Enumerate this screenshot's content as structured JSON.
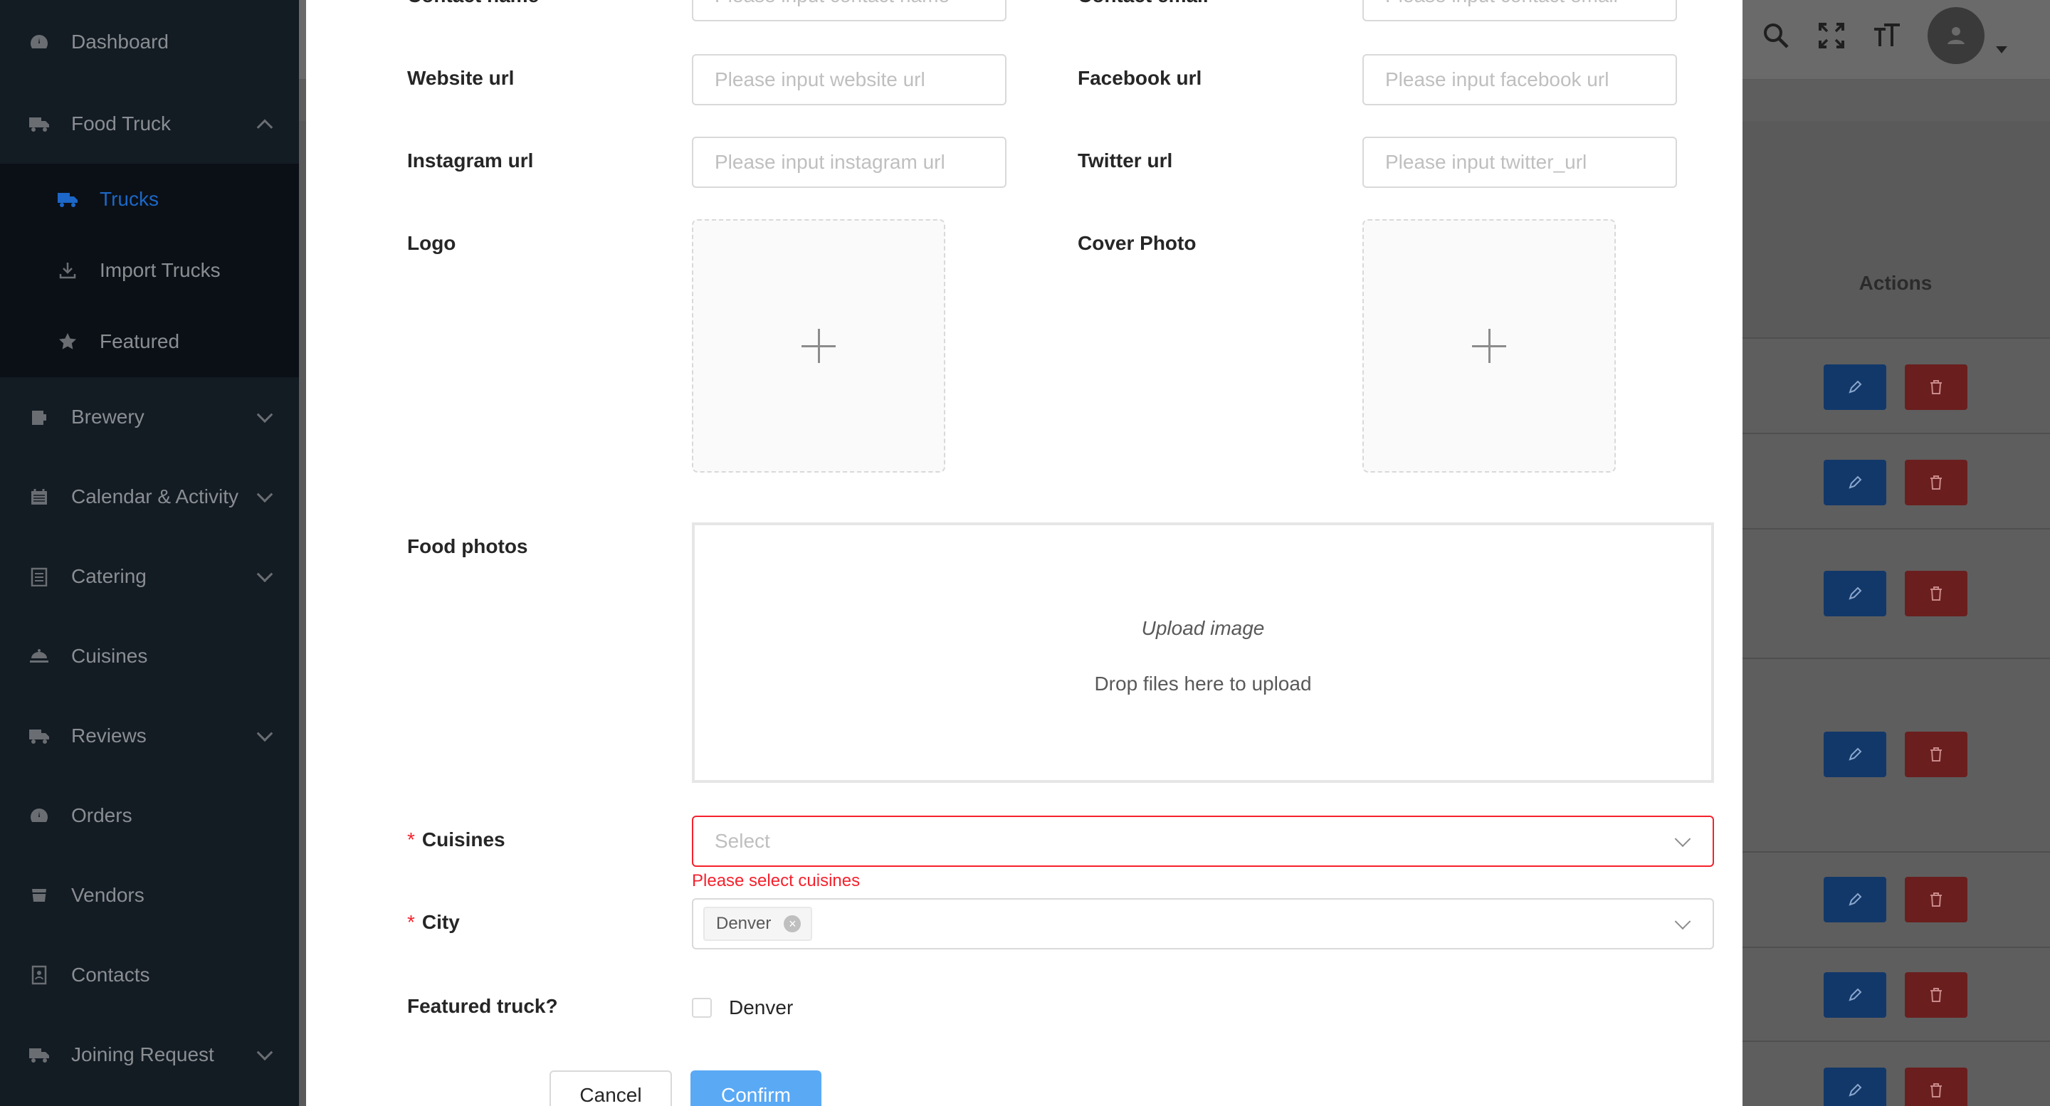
{
  "sidebar": {
    "items": [
      {
        "label": "Dashboard",
        "icon": "dashboard-icon"
      },
      {
        "label": "Food Truck",
        "icon": "truck-icon",
        "expanded": true,
        "children": [
          {
            "label": "Trucks",
            "icon": "truck-icon",
            "active": true
          },
          {
            "label": "Import Trucks",
            "icon": "download-icon"
          },
          {
            "label": "Featured",
            "icon": "star-icon"
          }
        ]
      },
      {
        "label": "Brewery",
        "icon": "beer-icon"
      },
      {
        "label": "Calendar & Activity",
        "icon": "calendar-icon"
      },
      {
        "label": "Catering",
        "icon": "clipboard-icon"
      },
      {
        "label": "Cuisines",
        "icon": "dish-icon"
      },
      {
        "label": "Reviews",
        "icon": "truck-icon"
      },
      {
        "label": "Orders",
        "icon": "dashboard-icon"
      },
      {
        "label": "Vendors",
        "icon": "vendor-icon"
      },
      {
        "label": "Contacts",
        "icon": "contacts-icon"
      },
      {
        "label": "Joining Request",
        "icon": "truck-icon"
      }
    ]
  },
  "header": {
    "icons": [
      "search-icon",
      "fullscreen-icon",
      "font-size-icon",
      "avatar-icon"
    ]
  },
  "table": {
    "actions_header": "Actions"
  },
  "form": {
    "contact_name_label": "Contact name",
    "contact_name_placeholder": "Please input contact name",
    "contact_email_label": "Contact email",
    "contact_email_placeholder": "Please input contact email",
    "website_label": "Website url",
    "website_placeholder": "Please input website url",
    "facebook_label": "Facebook url",
    "facebook_placeholder": "Please input facebook url",
    "instagram_label": "Instagram url",
    "instagram_placeholder": "Please input instagram url",
    "twitter_label": "Twitter url",
    "twitter_placeholder": "Please input twitter_url",
    "logo_label": "Logo",
    "cover_label": "Cover Photo",
    "food_photos_label": "Food photos",
    "upload_title": "Upload image",
    "upload_hint": "Drop files here to upload",
    "cuisines_label": "Cuisines",
    "cuisines_placeholder": "Select",
    "cuisines_error": "Please select cuisines",
    "city_label": "City",
    "city_tag": "Denver",
    "featured_label": "Featured truck?",
    "featured_option": "Denver",
    "required_mark": "*",
    "cancel_label": "Cancel",
    "confirm_label": "Confirm"
  },
  "colors": {
    "sidebar_bg": "#131b23",
    "active": "#1c67c7",
    "error": "#f5222d",
    "confirm": "#5aa9f5"
  }
}
